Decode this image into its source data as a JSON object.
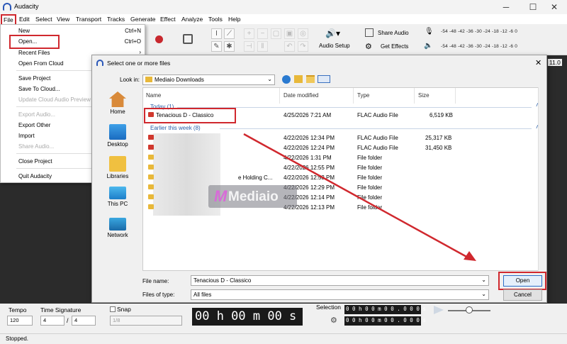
{
  "window": {
    "title": "Audacity",
    "ctrl_min": "─",
    "ctrl_max": "☐",
    "ctrl_close": "✕"
  },
  "menubar": [
    "File",
    "Edit",
    "Select",
    "View",
    "Transport",
    "Tracks",
    "Generate",
    "Effect",
    "Analyze",
    "Tools",
    "Help"
  ],
  "file_menu": {
    "items": [
      {
        "label": "New",
        "shortcut": "Ctrl+N",
        "enabled": true
      },
      {
        "label": "Open...",
        "shortcut": "Ctrl+O",
        "enabled": true
      },
      {
        "label": "Recent Files",
        "shortcut": "›",
        "enabled": true
      },
      {
        "label": "Open From Cloud",
        "shortcut": "",
        "enabled": true
      },
      {
        "label": "Save Project",
        "shortcut": "›",
        "enabled": true
      },
      {
        "label": "Save To Cloud...",
        "shortcut": "",
        "enabled": true
      },
      {
        "label": "Update Cloud Audio Preview",
        "shortcut": "",
        "enabled": false
      },
      {
        "label": "Export Audio...",
        "shortcut": "",
        "enabled": false
      },
      {
        "label": "Export Other",
        "shortcut": "",
        "enabled": true
      },
      {
        "label": "Import",
        "shortcut": "",
        "enabled": true
      },
      {
        "label": "Share Audio...",
        "shortcut": "",
        "enabled": false
      },
      {
        "label": "Close Project",
        "shortcut": "",
        "enabled": true
      },
      {
        "label": "Quit Audacity",
        "shortcut": "",
        "enabled": true
      }
    ]
  },
  "toolbar": {
    "audio_setup": "Audio Setup",
    "share_audio": "Share Audio",
    "get_effects": "Get Effects",
    "meter_scale": "-54  -48  -42  -36  -30  -24  -18  -12  -6   0",
    "meter_lr": "L\nR",
    "zoom_value": "11.0"
  },
  "dialog": {
    "title": "Select one or more files",
    "look_in_label": "Look in:",
    "look_in_value": "Mediaio Downloads",
    "places": [
      "Home",
      "Desktop",
      "Libraries",
      "This PC",
      "Network"
    ],
    "columns": [
      "Name",
      "Date modified",
      "Type",
      "Size"
    ],
    "groups": {
      "today": "Today (1)",
      "week": "Earlier this week (8)"
    },
    "today_files": [
      {
        "name": "Tenacious D - Classico",
        "date": "4/25/2026 7:21 AM",
        "type": "FLAC Audio File",
        "size": "6,519 KB"
      }
    ],
    "week_files": [
      {
        "name": "",
        "date": "4/22/2026 12:34 PM",
        "type": "FLAC Audio File",
        "size": "25,317 KB",
        "kind": "flac"
      },
      {
        "name": "",
        "date": "4/22/2026 12:24 PM",
        "type": "FLAC Audio File",
        "size": "31,450 KB",
        "kind": "flac"
      },
      {
        "name": "",
        "date": "4/22/2026 1:31 PM",
        "type": "File folder",
        "size": "",
        "kind": "folder"
      },
      {
        "name": "",
        "date": "4/22/2026 12:55 PM",
        "type": "File folder",
        "size": "",
        "kind": "folder"
      },
      {
        "name": "e Holding C...",
        "date": "4/22/2026 12:53 PM",
        "type": "File folder",
        "size": "",
        "kind": "folder"
      },
      {
        "name": "",
        "date": "4/22/2026 12:29 PM",
        "type": "File folder",
        "size": "",
        "kind": "folder"
      },
      {
        "name": "",
        "date": "4/22/2026 12:14 PM",
        "type": "File folder",
        "size": "",
        "kind": "folder"
      },
      {
        "name": "",
        "date": "4/22/2026 12:13 PM",
        "type": "File folder",
        "size": "",
        "kind": "folder"
      }
    ],
    "file_name_label": "File name:",
    "file_name_value": "Tenacious D - Classico",
    "files_of_type_label": "Files of type:",
    "files_of_type_value": "All files",
    "open_button": "Open",
    "cancel_button": "Cancel",
    "close": "✕"
  },
  "watermark": "Mediaio",
  "bottom": {
    "tempo_label": "Tempo",
    "tempo_value": "120",
    "time_sig_label": "Time Signature",
    "time_sig_num": "4",
    "time_sig_slash": "/",
    "time_sig_den": "4",
    "snap_label": "Snap",
    "snap_value": "1/8",
    "time_display": "00 h 00 m 00 s",
    "selection_label": "Selection",
    "sel_start": "0 0 h 0 0 m 0 0 . 0 0 0 s",
    "sel_end": "0 0 h 0 0 m 0 0 . 0 0 0 s"
  },
  "status": "Stopped.",
  "colors": {
    "highlight": "#d0282e",
    "link_blue": "#2a5ea8"
  }
}
